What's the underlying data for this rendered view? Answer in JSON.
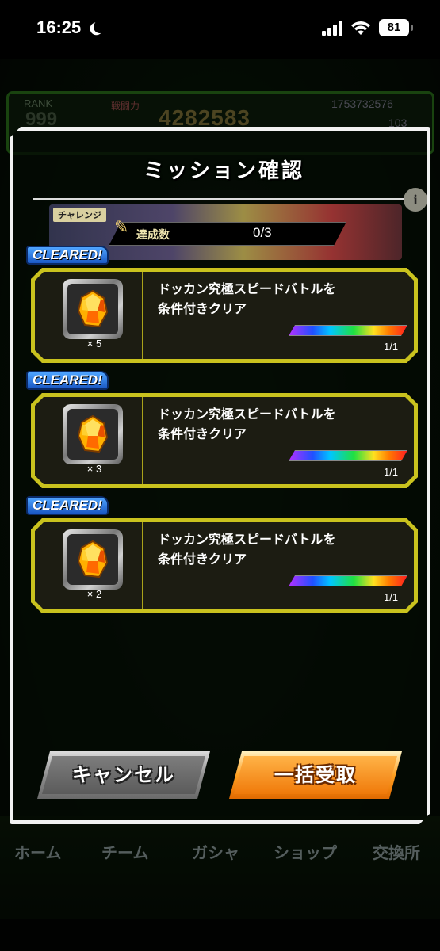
{
  "status_bar": {
    "time": "16:25",
    "battery": "81"
  },
  "background": {
    "rank_label": "RANK",
    "rank_value": "999",
    "power_label": "戦闘力",
    "power_value": "4282583",
    "stone_count": "1753732576",
    "zeni_count": "103",
    "nav": [
      "ホーム",
      "チーム",
      "ガシャ",
      "ショップ",
      "交換所"
    ]
  },
  "modal": {
    "title": "ミッション確認",
    "banner_tag": "チャレンジ",
    "progress_label": "達成数",
    "progress_count": "0/3",
    "missions": [
      {
        "cleared": "CLEARED!",
        "line1": "ドッカン究極スピードバトルを",
        "line2": "条件付きクリア",
        "qty": "× 5",
        "progress": "1/1",
        "fraction": 1.0
      },
      {
        "cleared": "CLEARED!",
        "line1": "ドッカン究極スピードバトルを",
        "line2": "条件付きクリア",
        "qty": "× 3",
        "progress": "1/1",
        "fraction": 1.0
      },
      {
        "cleared": "CLEARED!",
        "line1": "ドッカン究極スピードバトルを",
        "line2": "条件付きクリア",
        "qty": "× 2",
        "progress": "1/1",
        "fraction": 1.0
      }
    ],
    "cancel_label": "キャンセル",
    "receive_all_label": "一括受取"
  },
  "colors": {
    "card_border": "#c9c21e",
    "cleared_badge": "#1a58c4",
    "receive_button": "#f07a0a",
    "cancel_button": "#5b5b5b"
  }
}
